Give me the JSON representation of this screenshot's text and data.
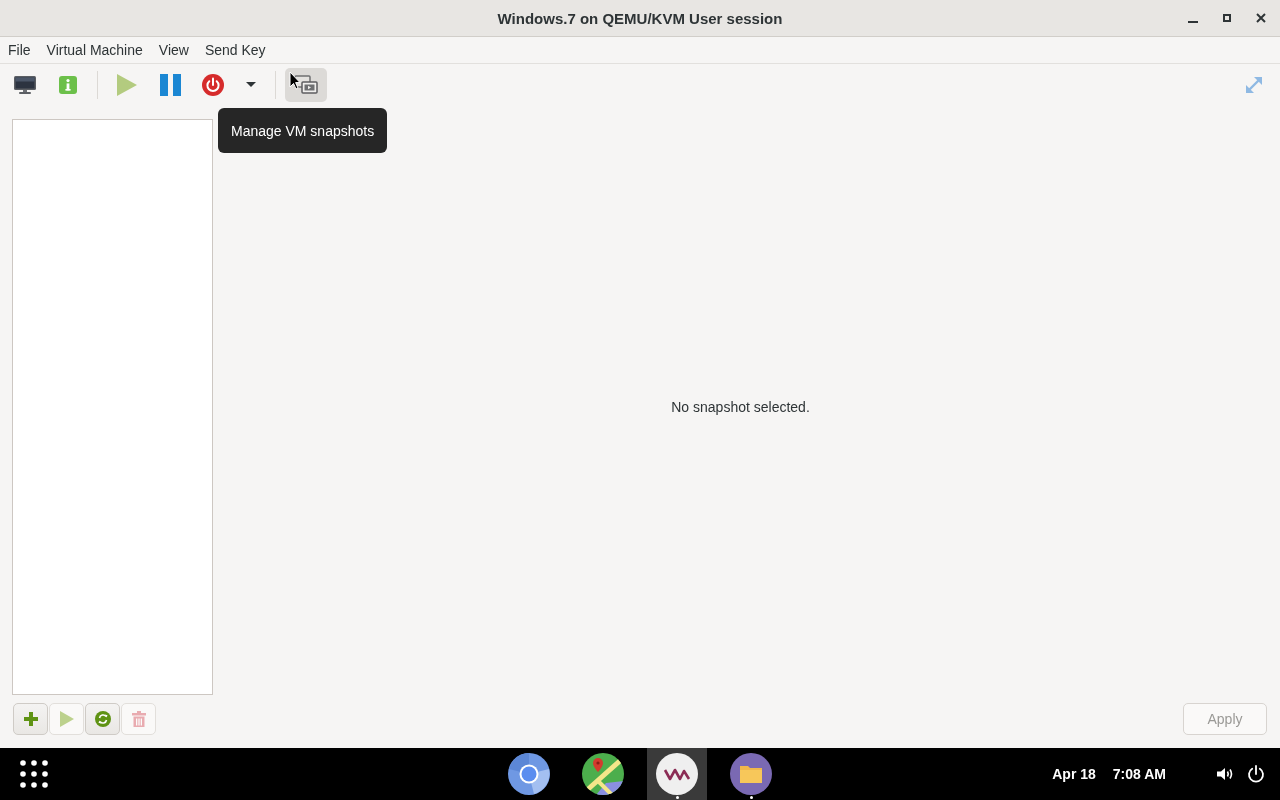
{
  "window": {
    "title": "Windows.7 on QEMU/KVM User session"
  },
  "menu": [
    {
      "label": "File"
    },
    {
      "label": "Virtual Machine"
    },
    {
      "label": "View"
    },
    {
      "label": "Send Key"
    }
  ],
  "toolbar": {
    "views": [
      {
        "kind": "console",
        "selected": false
      },
      {
        "kind": "details",
        "selected": false
      },
      {
        "kind": "snapshots",
        "selected": true
      }
    ],
    "controls": [
      {
        "kind": "run",
        "disabled": true
      },
      {
        "kind": "pause",
        "disabled": false
      },
      {
        "kind": "shutdown",
        "disabled": false
      }
    ]
  },
  "tooltip": {
    "text": "Manage VM snapshots"
  },
  "snapshots": {
    "empty_message": "No snapshot selected.",
    "actions": [
      {
        "kind": "add",
        "disabled": false
      },
      {
        "kind": "run",
        "disabled": true
      },
      {
        "kind": "revert",
        "disabled": false
      },
      {
        "kind": "delete",
        "disabled": true
      }
    ],
    "apply": {
      "label": "Apply",
      "disabled": true
    }
  },
  "taskbar": {
    "apps": [
      {
        "kind": "browser",
        "selected": false,
        "running": false
      },
      {
        "kind": "maps",
        "selected": false,
        "running": false
      },
      {
        "kind": "vm",
        "selected": true,
        "running": true
      },
      {
        "kind": "files",
        "selected": false,
        "running": true
      }
    ],
    "date": "Apr 18",
    "time": "7:08 AM"
  }
}
